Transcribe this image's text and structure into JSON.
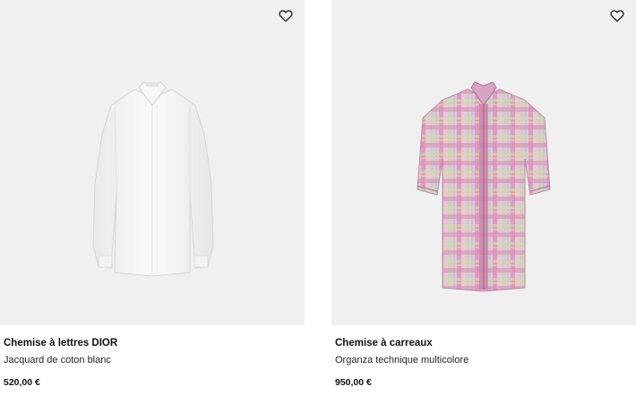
{
  "products": [
    {
      "title": "Chemise à lettres DIOR",
      "subtitle": "Jacquard de coton blanc",
      "price": "520,00 €",
      "image_icon": "white-shirt-image",
      "wishlist_icon": "heart-outline-icon"
    },
    {
      "title": "Chemise à carreaux",
      "subtitle": "Organza technique multicolore",
      "price": "950,00 €",
      "image_icon": "plaid-shirt-image",
      "wishlist_icon": "heart-outline-icon"
    }
  ],
  "colors": {
    "panel_bg": "#f0f0f0",
    "text": "#111111"
  }
}
